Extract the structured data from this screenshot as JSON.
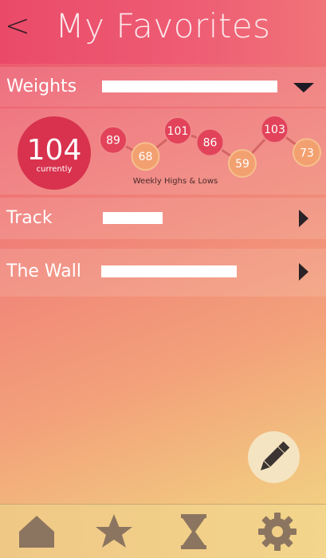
{
  "header": {
    "back_label": "<",
    "title": "My Favorites"
  },
  "sections": [
    {
      "label": "Weights",
      "expanded": true
    },
    {
      "label": "Track",
      "expanded": false
    },
    {
      "label": "The Wall",
      "expanded": false
    }
  ],
  "weights": {
    "current_value": "104",
    "current_label": "currently",
    "chart_caption": "Weekly Highs & Lows"
  },
  "chart_data": {
    "type": "line",
    "title": "Weekly Highs & Lows",
    "x": [
      1,
      2,
      3,
      4,
      5,
      6,
      7
    ],
    "values": [
      89,
      68,
      101,
      86,
      59,
      103,
      73
    ],
    "value_labels": [
      "89",
      "68",
      "101",
      "86",
      "59",
      "103",
      "73"
    ],
    "point_kinds": [
      "high",
      "low",
      "high",
      "high",
      "low",
      "high",
      "low"
    ],
    "grid": false
  },
  "colors": {
    "high": "#e2435a",
    "low": "#f3a070",
    "line": "#d56565",
    "current_circle": "#d8324e",
    "nav_icon": "#8c7560"
  },
  "nav": [
    "home-icon",
    "star-icon",
    "hourglass-icon",
    "gear-icon"
  ],
  "fab": "pencil-icon"
}
